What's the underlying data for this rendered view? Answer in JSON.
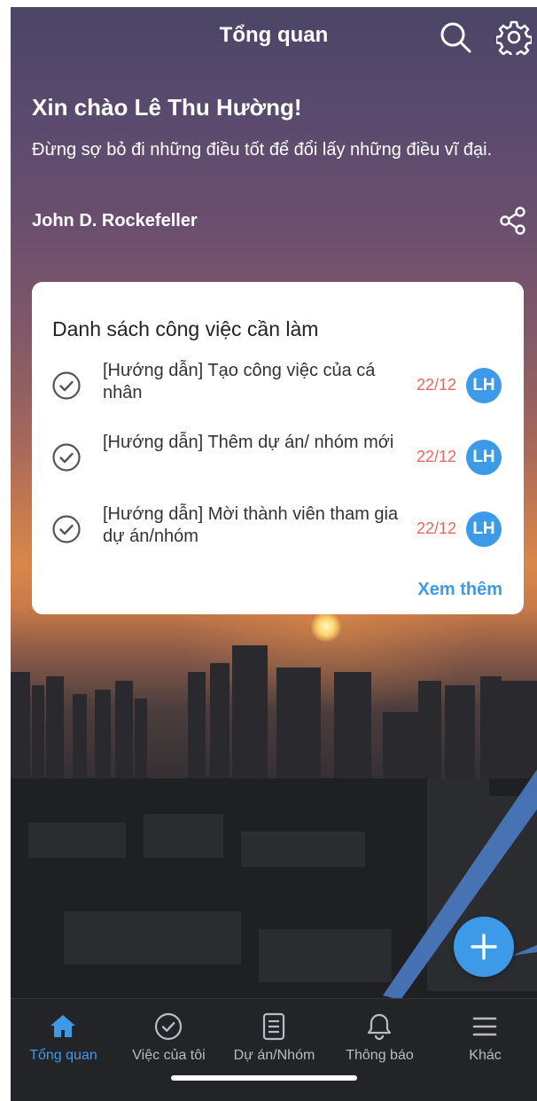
{
  "header": {
    "title": "Tổng quan"
  },
  "greeting": "Xin chào Lê Thu Hường!",
  "quote": {
    "text": "Đừng sợ bỏ đi những điều tốt để đổi lấy những điều vĩ đại.",
    "author": "John D. Rockefeller"
  },
  "todo": {
    "title": "Danh sách công việc cần làm",
    "tasks": [
      {
        "title": "[Hướng dẫn] Tạo công việc của cá nhân",
        "date": "22/12",
        "assignee": "LH"
      },
      {
        "title": "[Hướng dẫn] Thêm dự án/ nhóm mới",
        "date": "22/12",
        "assignee": "LH"
      },
      {
        "title": "[Hướng dẫn] Mời thành viên tham gia dự án/nhóm",
        "date": "22/12",
        "assignee": "LH"
      }
    ],
    "see_more": "Xem thêm"
  },
  "tabs": [
    {
      "label": "Tổng quan",
      "icon": "home-icon",
      "active": true
    },
    {
      "label": "Việc của tôi",
      "icon": "check-circle-icon",
      "active": false
    },
    {
      "label": "Dự án/Nhóm",
      "icon": "clipboard-icon",
      "active": false
    },
    {
      "label": "Thông báo",
      "icon": "bell-icon",
      "active": false
    },
    {
      "label": "Khác",
      "icon": "menu-icon",
      "active": false
    }
  ],
  "colors": {
    "accent": "#3d9ae8",
    "date": "#e8695f",
    "tabbar_bg": "#232428"
  }
}
